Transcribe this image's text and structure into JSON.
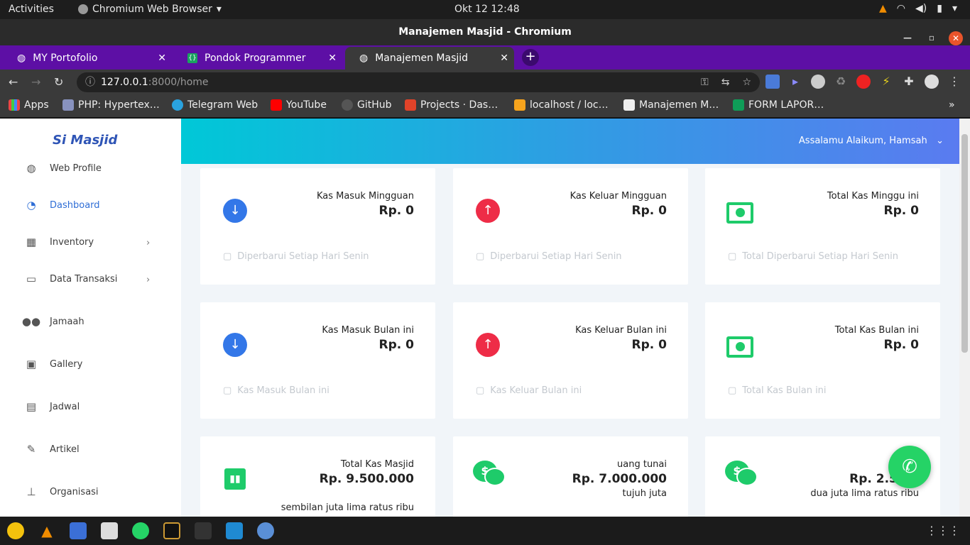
{
  "os": {
    "activities": "Activities",
    "app_name": "Chromium Web Browser",
    "clock": "Okt 12  12:48"
  },
  "window": {
    "title": "Manajemen Masjid - Chromium"
  },
  "tabs": [
    {
      "label": "MY Portofolio"
    },
    {
      "label": "Pondok Programmer"
    },
    {
      "label": "Manajemen Masjid"
    }
  ],
  "address": {
    "host": "127.0.0.1",
    "path": ":8000/home"
  },
  "bookmarks": [
    {
      "label": "Apps"
    },
    {
      "label": "PHP: Hypertex…"
    },
    {
      "label": "Telegram Web"
    },
    {
      "label": "YouTube"
    },
    {
      "label": "GitHub"
    },
    {
      "label": "Projects · Das…"
    },
    {
      "label": "localhost / loc…"
    },
    {
      "label": "Manajemen M…"
    },
    {
      "label": "FORM LAPOR…"
    }
  ],
  "sidebar": {
    "logo": "Si Masjid",
    "items": [
      {
        "label": "Web Profile",
        "icon": "globe-icon"
      },
      {
        "label": "Dashboard",
        "icon": "speedometer-icon"
      },
      {
        "label": "Inventory",
        "icon": "boxes-icon"
      },
      {
        "label": "Data Transaksi",
        "icon": "money-icon"
      },
      {
        "label": "Jamaah",
        "icon": "users-icon"
      },
      {
        "label": "Gallery",
        "icon": "image-icon"
      },
      {
        "label": "Jadwal",
        "icon": "calendar-icon"
      },
      {
        "label": "Artikel",
        "icon": "pencil-icon"
      },
      {
        "label": "Organisasi",
        "icon": "sitemap-icon"
      }
    ]
  },
  "header": {
    "greeting": "Assalamu Alaikum, Hamsah"
  },
  "cards": [
    {
      "title": "Kas Masuk Mingguan",
      "value": "Rp. 0",
      "footer": "Diperbarui Setiap Hari Senin"
    },
    {
      "title": "Kas Keluar Mingguan",
      "value": "Rp. 0",
      "footer": "Diperbarui Setiap Hari Senin"
    },
    {
      "title": "Total Kas Minggu ini",
      "value": "Rp. 0",
      "footer": "Total Diperbarui Setiap Hari Senin"
    },
    {
      "title": "Kas Masuk Bulan ini",
      "value": "Rp. 0",
      "footer": "Kas Masuk Bulan ini"
    },
    {
      "title": "Kas Keluar Bulan ini",
      "value": "Rp. 0",
      "footer": "Kas Keluar Bulan ini"
    },
    {
      "title": "Total Kas Bulan ini",
      "value": "Rp. 0",
      "footer": "Total Kas Bulan ini"
    },
    {
      "title": "Total Kas Masjid",
      "value": "Rp. 9.500.000",
      "sub": "sembilan juta lima ratus ribu"
    },
    {
      "title": "uang tunai",
      "value": "Rp. 7.000.000",
      "sub": "tujuh juta"
    },
    {
      "title": "",
      "value": "Rp. 2.500.",
      "sub": "dua juta lima ratus ribu"
    }
  ],
  "colors": {
    "accent_blue": "#3377e8",
    "accent_red": "#ee2c47",
    "accent_green": "#1ecb6a",
    "tab_strip": "#5d0fa5"
  }
}
